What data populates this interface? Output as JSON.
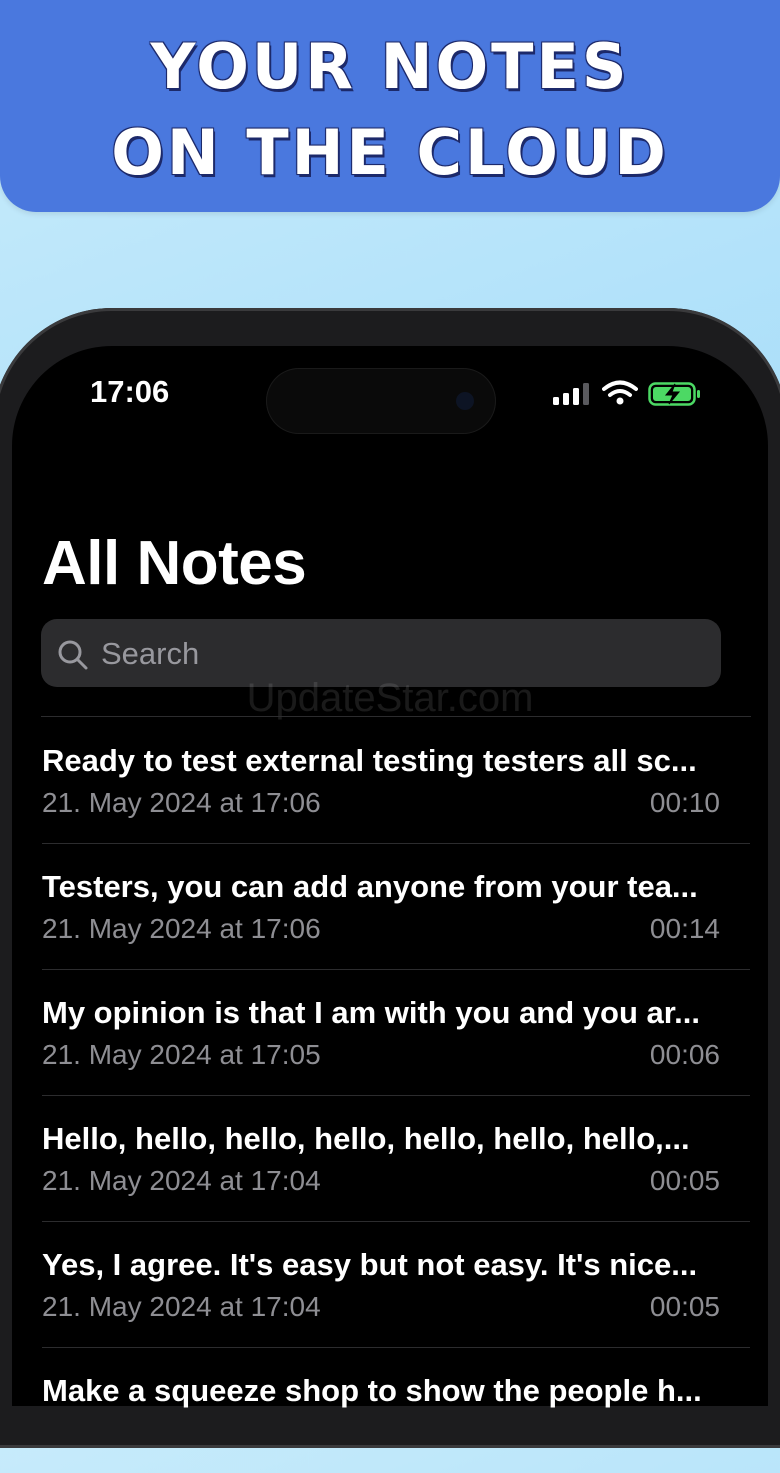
{
  "banner": {
    "line1": "YOUR NOTES",
    "line2": "ON THE CLOUD"
  },
  "status_bar": {
    "time": "17:06",
    "icons": [
      "cellular-signal-icon",
      "wifi-icon",
      "battery-charging-icon"
    ],
    "battery_color": "#4cd964"
  },
  "page": {
    "title": "All Notes"
  },
  "search": {
    "placeholder": "Search",
    "value": ""
  },
  "watermark": "UpdateStar.com",
  "notes": [
    {
      "title": "Ready to test external testing testers all sc...",
      "date": "21. May 2024 at 17:06",
      "duration": "00:10"
    },
    {
      "title": "Testers, you can add anyone from your tea...",
      "date": "21. May 2024 at 17:06",
      "duration": "00:14"
    },
    {
      "title": "My opinion is that I am with you and you ar...",
      "date": "21. May 2024 at 17:05",
      "duration": "00:06"
    },
    {
      "title": "Hello, hello, hello, hello, hello, hello, hello,...",
      "date": "21. May 2024 at 17:04",
      "duration": "00:05"
    },
    {
      "title": "Yes, I agree. It's easy but not easy. It's nice...",
      "date": "21. May 2024 at 17:04",
      "duration": "00:05"
    },
    {
      "title": "Make a squeeze shop to show the people h...",
      "date": "",
      "duration": ""
    }
  ],
  "colors": {
    "banner": "#4a78de",
    "screen_bg": "#000000",
    "search_bg": "#2c2c2e",
    "secondary_text": "#8e8e93"
  }
}
